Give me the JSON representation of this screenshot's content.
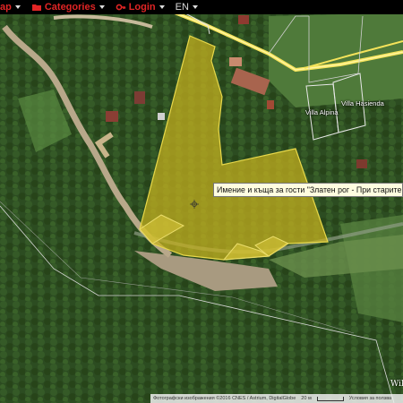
{
  "topbar": {
    "map_label": "ap",
    "categories_label": "Categories",
    "login_label": "Login",
    "language": "EN"
  },
  "map": {
    "villas": [
      {
        "id": "alpina",
        "label": "Villa Alpina"
      },
      {
        "id": "hasienda",
        "label": "Villa Hasienda"
      }
    ],
    "tooltip": "Имение и къща за гости \"Златен рог - При старите къщи\" (",
    "highlight_color": "#c8b21e"
  },
  "footer": {
    "attribution": "Фотографски изображения ©2016 CNES / Astrium, DigitalGlobe",
    "scale": "20 м",
    "terms": "Условия за ползва",
    "wiki": "Wik"
  }
}
